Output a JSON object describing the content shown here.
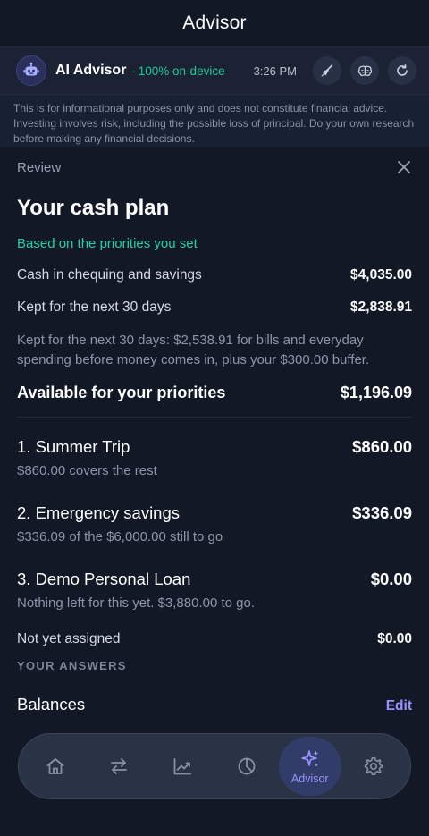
{
  "header": {
    "title": "Advisor"
  },
  "advisor": {
    "name": "AI Advisor",
    "separator": "·",
    "status": "100% on-device",
    "time": "3:26 PM",
    "actions": [
      "broom-icon",
      "brain-icon",
      "refresh-icon"
    ]
  },
  "disclaimer": "This is for informational purposes only and does not constitute financial advice. Investing involves risk, including the possible loss of principal. Do your own research before making any financial decisions.",
  "review": {
    "label": "Review"
  },
  "plan": {
    "title": "Your cash plan",
    "note": "Based on the priorities you set",
    "cash_label": "Cash in chequing and savings",
    "cash_value": "$4,035.00",
    "kept_label": "Kept for the next 30 days",
    "kept_value": "$2,838.91",
    "explain": "Kept for the next 30 days: $2,538.91 for bills and everyday spending before money comes in, plus your $300.00 buffer.",
    "available_label": "Available for your priorities",
    "available_value": "$1,196.09"
  },
  "priorities": [
    {
      "name": "1. Summer Trip",
      "amount": "$860.00",
      "sub": "$860.00 covers the rest"
    },
    {
      "name": "2. Emergency savings",
      "amount": "$336.09",
      "sub": "$336.09 of the $6,000.00 still to go"
    },
    {
      "name": "3. Demo Personal Loan",
      "amount": "$0.00",
      "sub": "Nothing left for this yet. $3,880.00 to go."
    }
  ],
  "unassigned": {
    "label": "Not yet assigned",
    "value": "$0.00"
  },
  "answers": {
    "heading": "YOUR ANSWERS",
    "balances_title": "Balances",
    "edit_label": "Edit"
  },
  "tabbar": {
    "tabs": [
      {
        "icon": "home-icon"
      },
      {
        "icon": "transfer-icon"
      },
      {
        "icon": "chart-line-icon"
      },
      {
        "icon": "pie-chart-icon"
      },
      {
        "icon": "sparkle-icon",
        "label": "Advisor",
        "active": true
      },
      {
        "icon": "gear-icon"
      }
    ]
  },
  "colors": {
    "background": "#121826",
    "accent_green": "#22c79a",
    "accent_purple": "#9b93ff"
  }
}
